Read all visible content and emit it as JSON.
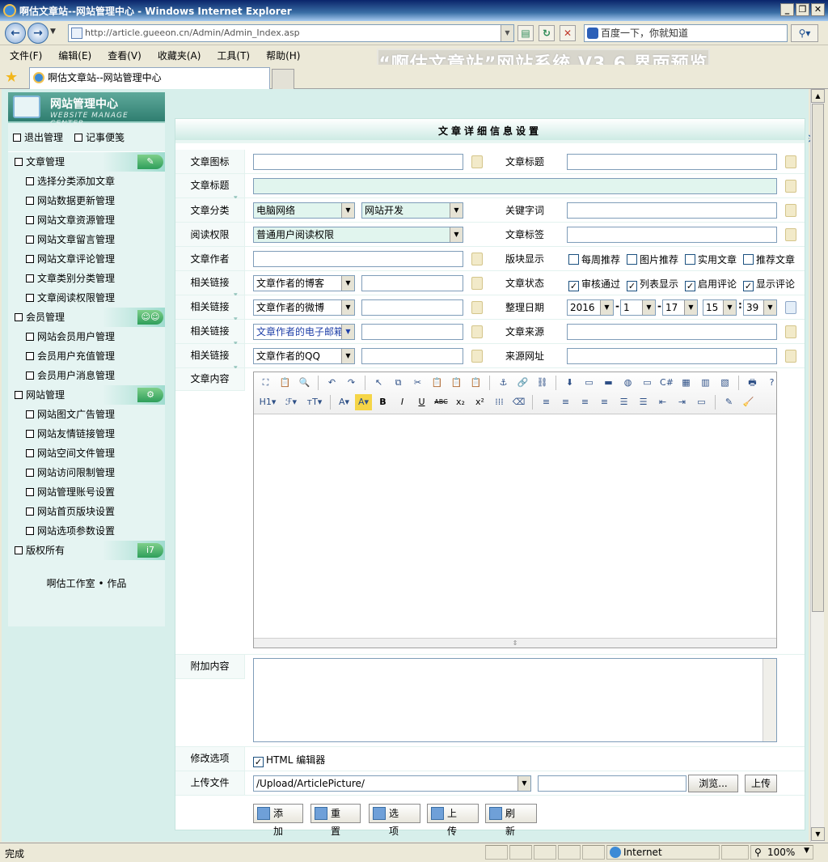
{
  "window": {
    "title": "啊估文章站--网站管理中心 - Windows Internet Explorer",
    "url": "http://article.gueeon.cn/Admin/Admin_Index.asp",
    "search_placeholder": "百度一下，你就知道"
  },
  "menu": [
    "文件(F)",
    "编辑(E)",
    "查看(V)",
    "收藏夹(A)",
    "工具(T)",
    "帮助(H)"
  ],
  "banner": "“啊估文章站”网站系统 V3.6 界面预览",
  "tab_title": "啊估文章站--网站管理中心",
  "sidebar": {
    "header_title": "网站管理中心",
    "header_subtitle": "WEBSITE MANAGE CENTER",
    "quick": [
      "退出管理",
      "记事便笺"
    ],
    "groups": [
      {
        "name": "文章管理",
        "icon": "folder-pen-icon",
        "items": [
          "选择分类添加文章",
          "网站数据更新管理",
          "网站文章资源管理",
          "网站文章留言管理",
          "网站文章评论管理",
          "文章类别分类管理",
          "文章阅读权限管理"
        ]
      },
      {
        "name": "会员管理",
        "icon": "users-icon",
        "items": [
          "网站会员用户管理",
          "会员用户充值管理",
          "会员用户消息管理"
        ]
      },
      {
        "name": "网站管理",
        "icon": "gears-icon",
        "items": [
          "网站图文广告管理",
          "网站友情链接管理",
          "网站空间文件管理",
          "网站访问限制管理",
          "网站管理账号设置",
          "网站首页版块设置",
          "网站选项参数设置"
        ]
      },
      {
        "name": "版权所有",
        "icon": "logo-icon",
        "items": []
      }
    ],
    "footer": "啊估工作室 • 作品"
  },
  "form": {
    "title": "文章详细信息设置",
    "labels": {
      "icon": "文章图标",
      "title_right": "文章标题",
      "title": "文章标题",
      "category": "文章分类",
      "keywords": "关键字词",
      "permission": "阅读权限",
      "tags": "文章标签",
      "author": "文章作者",
      "block": "版块显示",
      "link": "相关链接",
      "status": "文章状态",
      "date": "整理日期",
      "source": "文章来源",
      "source_url": "来源网址",
      "content": "文章内容",
      "extra": "附加内容",
      "options": "修改选项",
      "upload": "上传文件"
    },
    "category1": "电脑网络",
    "category2": "网站开发",
    "permission_value": "普通用户阅读权限",
    "link_selects": [
      "文章作者的博客",
      "文章作者的微博",
      "文章作者的电子邮箱",
      "文章作者的QQ"
    ],
    "block_options": [
      "每周推荐",
      "图片推荐",
      "实用文章",
      "推荐文章"
    ],
    "status_options": [
      "审核通过",
      "列表显示",
      "启用评论",
      "显示评论"
    ],
    "date": {
      "year": "2016",
      "month": "1",
      "day": "17",
      "hour": "15",
      "minute": "39"
    },
    "editor_row1": [
      "⛶",
      "📋",
      "🔍",
      "↶",
      "↷",
      "↖",
      "⧉",
      "✂",
      "📋",
      "📋",
      "📋",
      "⚓",
      "🔗",
      "⛓",
      "⬇",
      "▭",
      "▬",
      "◍",
      "▭",
      "C#",
      "▦",
      "▥",
      "▧",
      "🖶",
      "?"
    ],
    "editor_row2": [
      "H1▾",
      "ℱ▾",
      "тТ▾",
      "A▾",
      "A▾",
      "B",
      "I",
      "U",
      "ABC",
      "x₂",
      "x²",
      "⁞⁞⁞",
      "⌫",
      "≡",
      "≡",
      "≡",
      "≡",
      "☰",
      "☰",
      "⇤",
      "⇥",
      "▭",
      "✎",
      "🧹"
    ],
    "html_editor": "HTML 编辑器",
    "upload_path": "/Upload/ArticlePicture/",
    "browse": "浏览...",
    "upload_button": "上传",
    "actions": [
      "添 加",
      "重 置",
      "选 项",
      "上 传",
      "刷 新"
    ]
  },
  "status": {
    "left": "完成",
    "zone": "Internet",
    "zoom": "100%"
  }
}
